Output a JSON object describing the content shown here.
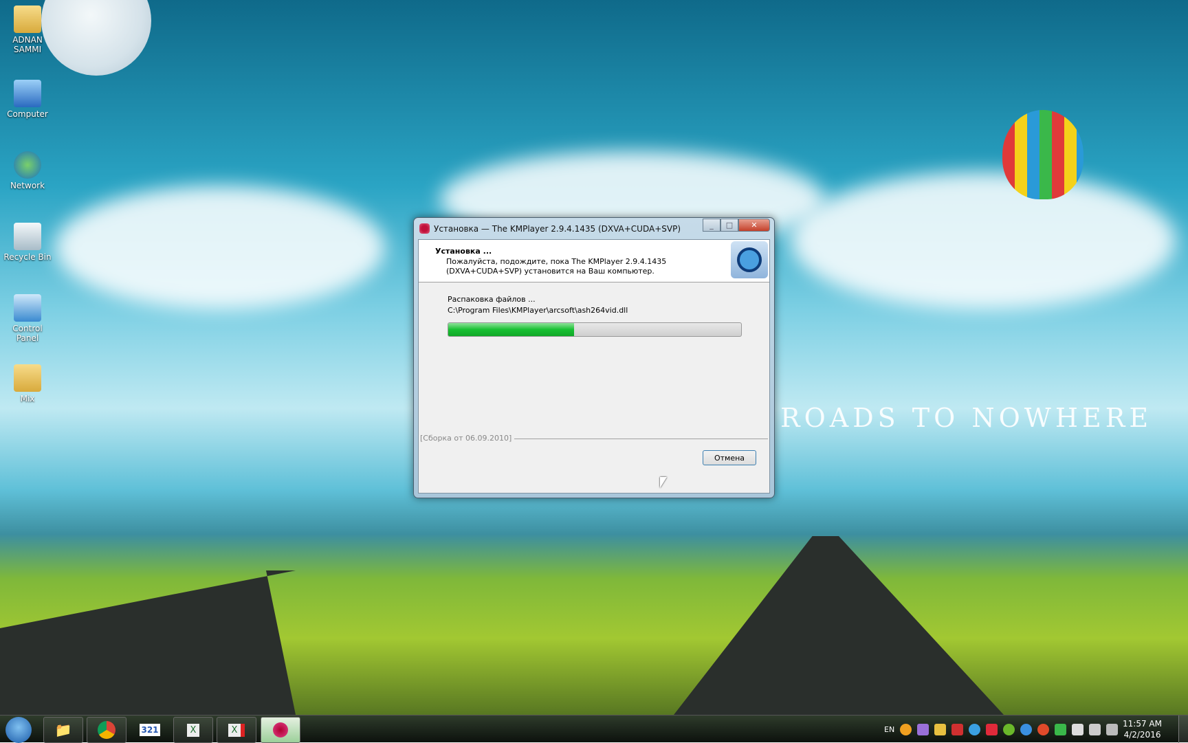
{
  "desktop": {
    "icons": [
      {
        "label": "ADNAN SAMMI"
      },
      {
        "label": "Computer"
      },
      {
        "label": "Network"
      },
      {
        "label": "Recycle Bin"
      },
      {
        "label": "Control Panel"
      },
      {
        "label": "Mix"
      }
    ],
    "wallpaper_text": "ROADS TO NOWHERE"
  },
  "dialog": {
    "title": "Установка — The KMPlayer 2.9.4.1435 (DXVA+CUDA+SVP)",
    "header_title": "Установка ...",
    "header_desc": "Пожалуйста, подождите, пока The KMPlayer 2.9.4.1435 (DXVA+CUDA+SVP) установится на Ваш компьютер.",
    "status": "Распаковка файлов ...",
    "file": "C:\\Program Files\\KMPlayer\\arcsoft\\ash264vid.dll",
    "progress_percent": 43,
    "build": "[Сборка от 06.09.2010]",
    "cancel_label": "Отмена",
    "close_glyph": "✕"
  },
  "taskbar": {
    "apps": [
      "windows-explorer",
      "google-chrome",
      "media-player-classic",
      "excel",
      "excel-recording",
      "kmplayer"
    ],
    "language": "EN",
    "time": "11:57 AM",
    "date": "4/2/2016",
    "colors": {
      "progress": "#18c032",
      "accent": "#3c7fb1"
    }
  }
}
